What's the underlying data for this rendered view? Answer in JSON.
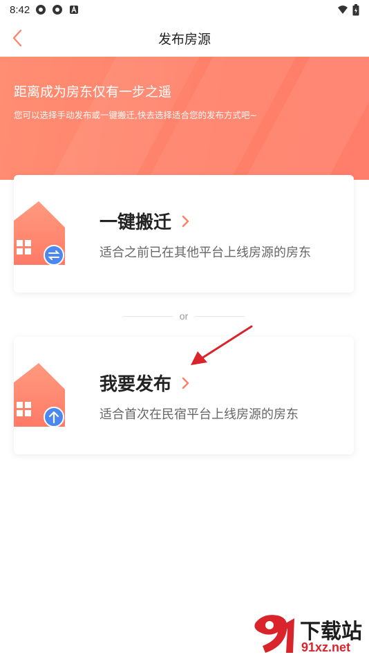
{
  "status_bar": {
    "time": "8:42"
  },
  "nav": {
    "title": "发布房源"
  },
  "hero": {
    "title": "距离成为房东仅有一步之遥",
    "subtitle": "您可以选择手动发布或一键搬迁,快去选择适合您的发布方式吧~"
  },
  "options": [
    {
      "title": "一键搬迁",
      "description": "适合之前已在其他平台上线房源的房东",
      "badge_icon": "swap-arrows-icon"
    },
    {
      "title": "我要发布",
      "description": "适合首次在民宿平台上线房源的房东",
      "badge_icon": "upload-arrow-icon"
    }
  ],
  "divider": {
    "text": "or"
  },
  "watermark": {
    "top": "下载站",
    "bottom": "91xz.net",
    "logo": "91-logo"
  },
  "colors": {
    "accent": "#ff7f68",
    "badge": "#4d87f0",
    "annotation": "#d8242a"
  }
}
